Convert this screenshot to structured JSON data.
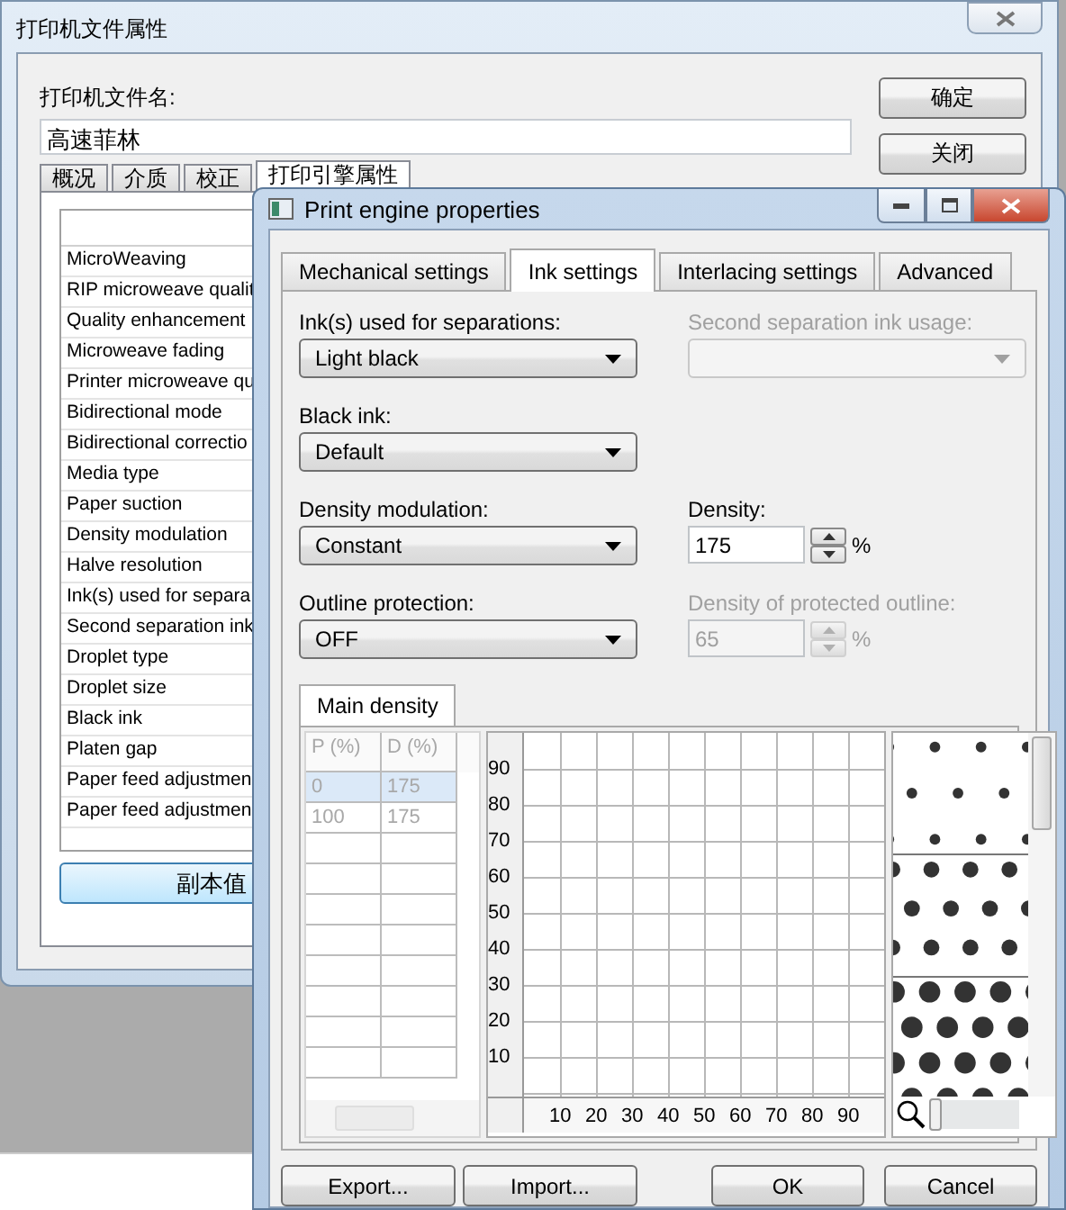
{
  "outer_window": {
    "title": "打印机文件属性",
    "file_name_label": "打印机文件名:",
    "file_name": "高速菲林",
    "buttons": [
      "确定",
      "关闭"
    ],
    "tabs": [
      {
        "label": "概况",
        "selected": false
      },
      {
        "label": "介质",
        "selected": false
      },
      {
        "label": "校正",
        "selected": false
      },
      {
        "label": "打印引擎属性",
        "selected": true
      }
    ],
    "settings_list": [
      "MicroWeaving",
      "RIP microweave qualit",
      "Quality enhancement",
      "Microweave fading",
      "Printer microweave qu",
      "Bidirectional mode",
      "Bidirectional correctio",
      "Media type",
      "Paper suction",
      "Density modulation",
      "Halve resolution",
      "Ink(s) used for separa",
      "Second separation ink",
      "Droplet type",
      "Droplet size",
      "Black ink",
      "Platen gap",
      "Paper feed adjustmen",
      "Paper feed adjustmen"
    ],
    "copy_button": "副本值"
  },
  "dialog": {
    "title": "Print engine properties",
    "tabs": [
      {
        "label": "Mechanical settings",
        "selected": false
      },
      {
        "label": "Ink settings",
        "selected": true
      },
      {
        "label": "Interlacing settings",
        "selected": false
      },
      {
        "label": "Advanced",
        "selected": false
      }
    ],
    "field_rows": [
      {
        "left": {
          "kind": "select",
          "label": "Ink(s) used for separations:",
          "value": "Light black",
          "disabled": false
        },
        "right": {
          "kind": "select",
          "label": "Second separation ink usage:",
          "disabled": true
        }
      },
      {
        "left": {
          "kind": "select",
          "label": "Black ink:",
          "value": "Default",
          "disabled": false
        }
      },
      {
        "left": {
          "kind": "select",
          "label": "Density modulation:",
          "value": "Constant",
          "disabled": false
        },
        "right": {
          "kind": "spin",
          "label": "Density:",
          "value": "175",
          "unit": "%",
          "disabled": false
        }
      },
      {
        "left": {
          "kind": "select",
          "label": "Outline protection:",
          "value": "OFF",
          "disabled": false
        },
        "right": {
          "kind": "spin",
          "label": "Density of protected outline:",
          "value": "65",
          "unit": "%",
          "disabled": true
        }
      }
    ],
    "sub_tabs": [
      {
        "label": "Main density",
        "selected": true
      }
    ],
    "density_table": {
      "columns": [
        "P (%)",
        "D (%)"
      ],
      "rows": [
        {
          "cells": [
            "0",
            "175"
          ],
          "selected": true
        },
        {
          "cells": [
            "100",
            "175"
          ],
          "selected": false
        }
      ]
    },
    "zoom": {
      "level": 0
    },
    "curve": {
      "y_ticks": [
        "90",
        "80",
        "70",
        "60",
        "50",
        "40",
        "30",
        "20",
        "10"
      ],
      "x_ticks": [
        "10",
        "20",
        "30",
        "40",
        "50",
        "60",
        "70",
        "80",
        "90"
      ]
    },
    "left_buttons": [
      "Export...",
      "Import..."
    ],
    "right_buttons": [
      "OK",
      "Cancel"
    ]
  }
}
